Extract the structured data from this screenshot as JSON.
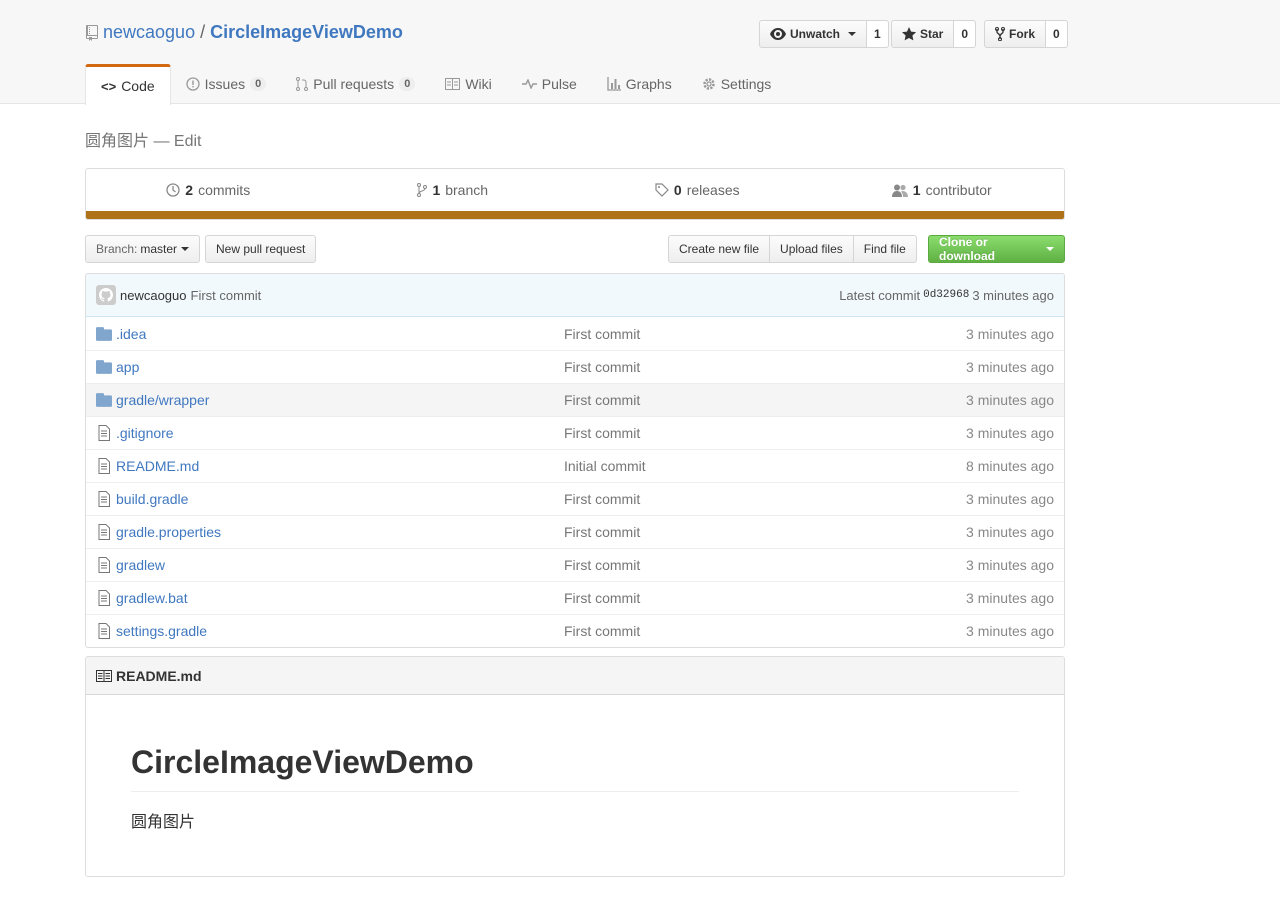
{
  "repo": {
    "owner": "newcaoguo",
    "separator": "/",
    "name": "CircleImageViewDemo"
  },
  "actions": {
    "watch": {
      "label": "Unwatch",
      "count": "1"
    },
    "star": {
      "label": "Star",
      "count": "0"
    },
    "fork": {
      "label": "Fork",
      "count": "0"
    }
  },
  "nav": {
    "code": "Code",
    "issues": {
      "label": "Issues",
      "count": "0"
    },
    "pulls": {
      "label": "Pull requests",
      "count": "0"
    },
    "wiki": "Wiki",
    "pulse": "Pulse",
    "graphs": "Graphs",
    "settings": "Settings"
  },
  "description": {
    "text": "圆角图片",
    "dash": " — ",
    "edit": "Edit"
  },
  "summary": {
    "commits": {
      "count": "2",
      "label": "commits"
    },
    "branches": {
      "count": "1",
      "label": "branch"
    },
    "releases": {
      "count": "0",
      "label": "releases"
    },
    "contributors": {
      "count": "1",
      "label": "contributor"
    },
    "language_color": "#b07219"
  },
  "filenav": {
    "branch_label": "Branch:",
    "branch_name": "master",
    "new_pr": "New pull request",
    "create_file": "Create new file",
    "upload": "Upload files",
    "find": "Find file",
    "clone": "Clone or download"
  },
  "commit": {
    "author": "newcaoguo",
    "message": "First commit",
    "latest_label": "Latest commit",
    "sha": "0d32968",
    "age": "3 minutes ago"
  },
  "files": [
    {
      "type": "dir",
      "name": ".idea",
      "message": "First commit",
      "age": "3 minutes ago"
    },
    {
      "type": "dir",
      "name": "app",
      "message": "First commit",
      "age": "3 minutes ago"
    },
    {
      "type": "dir",
      "name": "gradle/wrapper",
      "message": "First commit",
      "age": "3 minutes ago"
    },
    {
      "type": "file",
      "name": ".gitignore",
      "message": "First commit",
      "age": "3 minutes ago"
    },
    {
      "type": "file",
      "name": "README.md",
      "message": "Initial commit",
      "age": "8 minutes ago"
    },
    {
      "type": "file",
      "name": "build.gradle",
      "message": "First commit",
      "age": "3 minutes ago"
    },
    {
      "type": "file",
      "name": "gradle.properties",
      "message": "First commit",
      "age": "3 minutes ago"
    },
    {
      "type": "file",
      "name": "gradlew",
      "message": "First commit",
      "age": "3 minutes ago"
    },
    {
      "type": "file",
      "name": "gradlew.bat",
      "message": "First commit",
      "age": "3 minutes ago"
    },
    {
      "type": "file",
      "name": "settings.gradle",
      "message": "First commit",
      "age": "3 minutes ago"
    }
  ],
  "readme": {
    "filename": "README.md",
    "heading": "CircleImageViewDemo",
    "body": "圆角图片"
  },
  "colors": {
    "link": "#4078c0",
    "accent_tab": "#d26911",
    "green": "#6cc644"
  }
}
